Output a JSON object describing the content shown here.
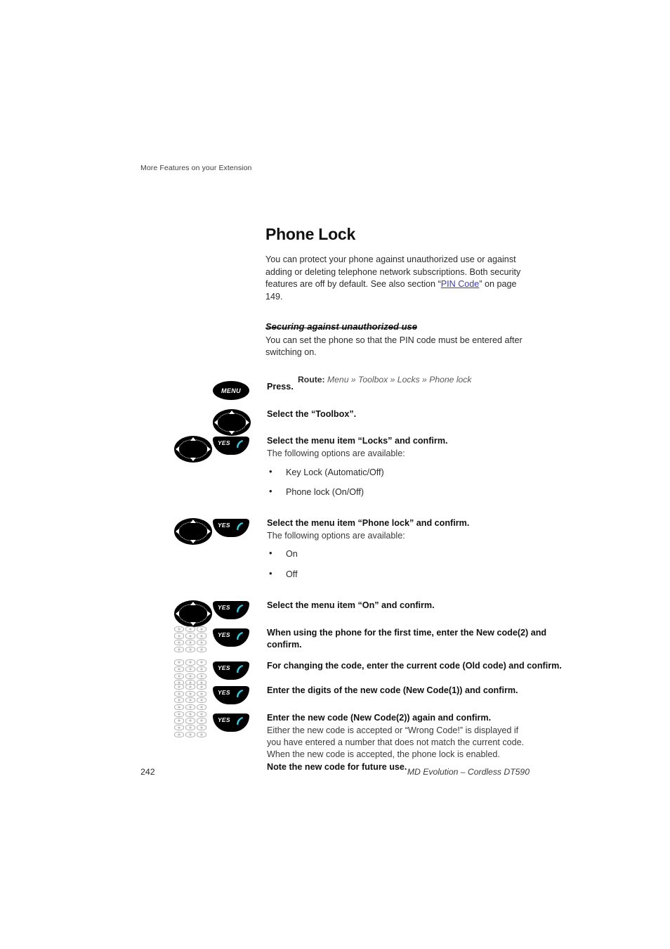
{
  "header": {
    "running_head": "More Features on your Extension"
  },
  "section": {
    "title": "Phone Lock",
    "intro_before_link": "You can protect your phone against unauthorized use or against adding or deleting telephone network subscriptions. Both security features are off by default. See also section “",
    "intro_link": "PIN Code",
    "intro_after_link": "” on page 149.",
    "subheading": "Securing against unauthorized use",
    "sub_paragraph": "You can set the phone so that the PIN code must be entered after switching on.",
    "route_label": "Route:",
    "route_path": "Menu » Toolbox » Locks » Phone lock"
  },
  "steps": [
    {
      "icons": [
        "menu-key"
      ],
      "title": "Press.",
      "subtitle": "",
      "options": []
    },
    {
      "icons": [
        "nav-key"
      ],
      "title": "Select the “Toolbox”.",
      "subtitle": "",
      "options": []
    },
    {
      "icons": [
        "nav-key",
        "yes-key"
      ],
      "title": "Select the menu item “Locks” and confirm.",
      "subtitle": "The following options are available:",
      "options": [
        "Key Lock (Automatic/Off)",
        "Phone lock (On/Off)"
      ]
    },
    {
      "icons": [
        "nav-key",
        "yes-key"
      ],
      "title": "Select the menu item “Phone lock” and confirm.",
      "subtitle": "The following options are available:",
      "options": [
        "On",
        "Off"
      ]
    },
    {
      "icons": [
        "nav-key",
        "yes-key"
      ],
      "title": "Select the menu item “On” and confirm.",
      "subtitle": "",
      "options": []
    },
    {
      "icons": [
        "keypad",
        "yes-key"
      ],
      "title": "When using the phone for the first time, enter the New code(2) and confirm.",
      "subtitle": "",
      "options": []
    },
    {
      "icons": [
        "keypad",
        "yes-key"
      ],
      "title": "For changing the code, enter the current code (Old code) and confirm.",
      "subtitle": "",
      "options": []
    },
    {
      "icons": [
        "keypad",
        "yes-key"
      ],
      "title": "Enter the digits of the new code (New Code(1)) and confirm.",
      "subtitle": "",
      "options": []
    },
    {
      "icons": [
        "keypad",
        "yes-key"
      ],
      "title": "Enter the new code (New Code(2)) again and confirm.",
      "subtitle": "",
      "options": [],
      "tail_lines": [
        "Either the new code is accepted or “Wrong Code!” is displayed if",
        "you have entered a number that does not match the current code.",
        "When the new code is accepted, the phone lock is enabled."
      ],
      "tail_bold": "Note the new code for future use."
    }
  ],
  "icon_labels": {
    "menu": "MENU",
    "yes": "YES"
  },
  "footer": {
    "page_number": "242",
    "document_reference": "MD Evolution – Cordless DT590"
  },
  "colors": {
    "link": "#3a3ac8",
    "handset": "#20d8e8",
    "key_black": "#000000"
  }
}
